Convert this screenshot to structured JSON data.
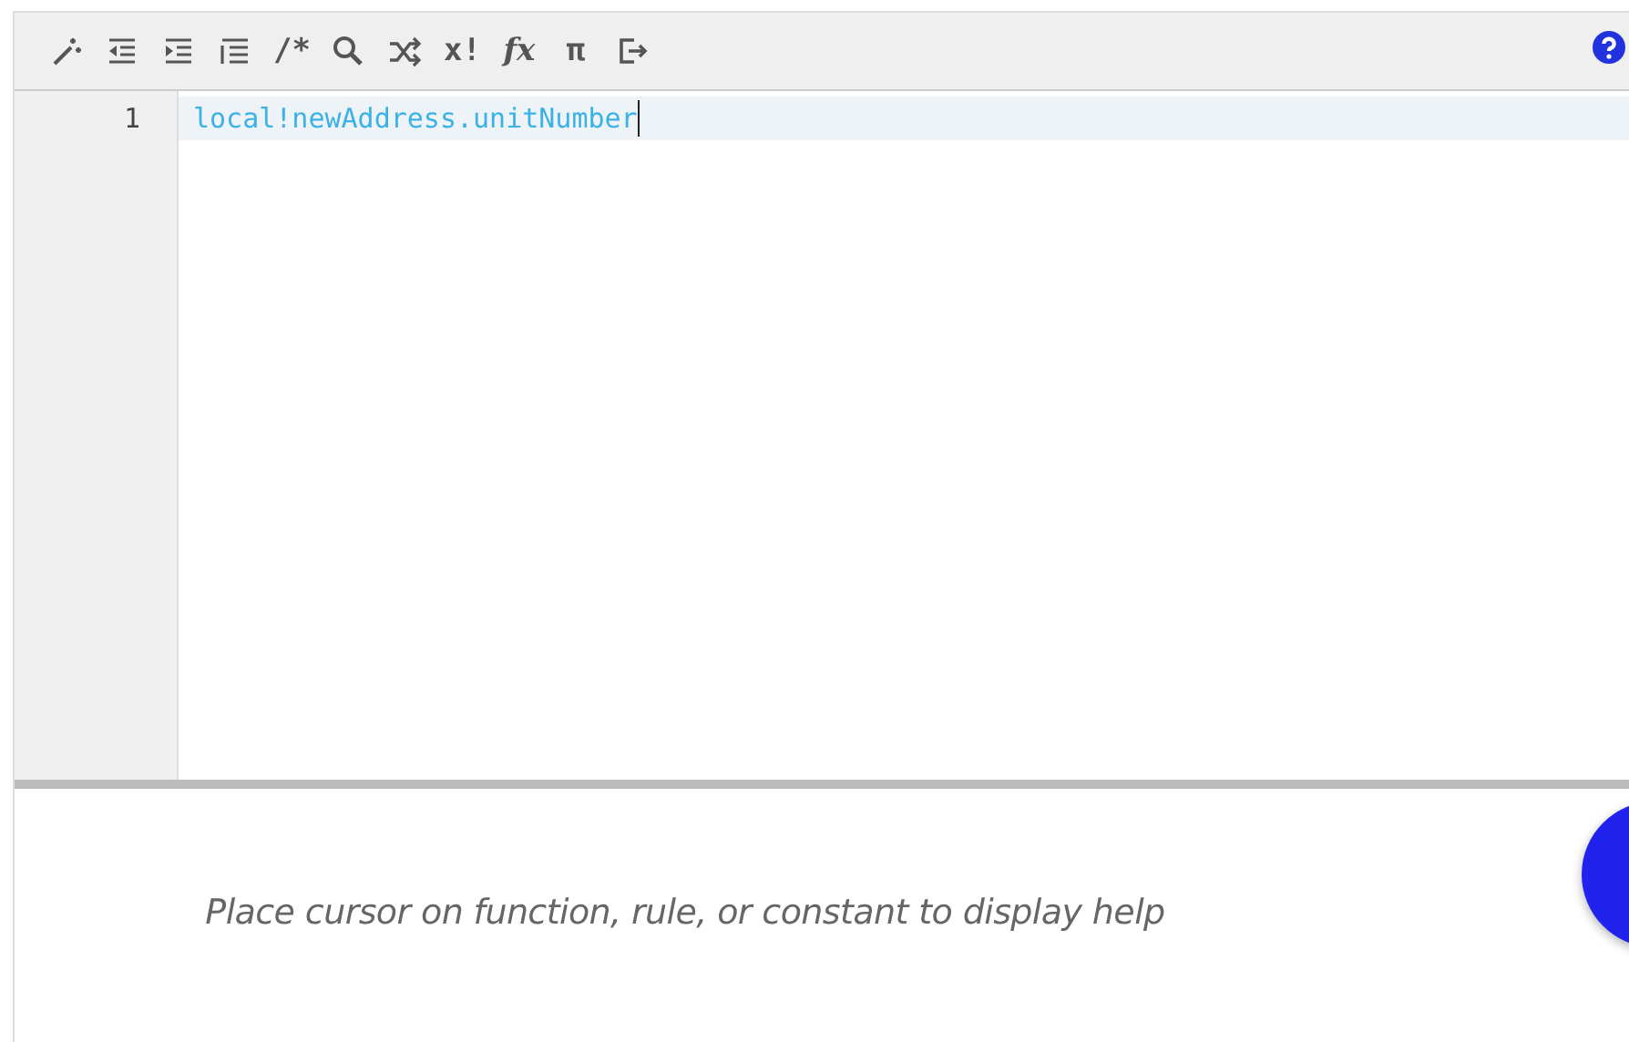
{
  "toolbar": {
    "buttons": [
      {
        "kind": "wand"
      },
      {
        "kind": "outdent"
      },
      {
        "kind": "indent"
      },
      {
        "kind": "list"
      },
      {
        "kind": "text",
        "label": "/*"
      },
      {
        "kind": "search"
      },
      {
        "kind": "shuffle"
      },
      {
        "kind": "text",
        "label": "x!"
      },
      {
        "kind": "italic",
        "label": "fx"
      },
      {
        "kind": "text",
        "label": "π"
      },
      {
        "kind": "exit"
      }
    ]
  },
  "editor": {
    "lines": [
      {
        "number": "1",
        "code": "local!newAddress.unitNumber",
        "active": true
      }
    ]
  },
  "help": {
    "message": "Place cursor on function, rule, or constant to display help"
  }
}
